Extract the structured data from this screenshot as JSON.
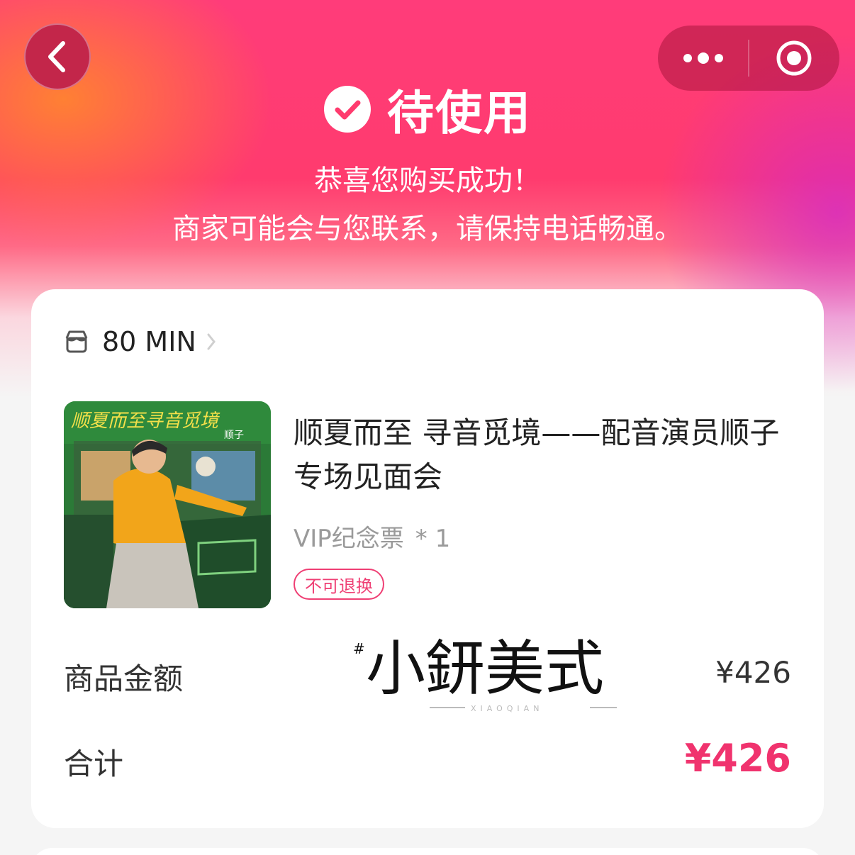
{
  "header": {
    "status": "待使用",
    "message_line1": "恭喜您购买成功！",
    "message_line2": "商家可能会与您联系，请保持电话畅通。"
  },
  "nav": {
    "back_icon": "chevron-left-icon",
    "more_icon": "more-dots-icon",
    "close_icon": "target-close-icon"
  },
  "order": {
    "shop_name": "80 MIN",
    "item_title": "顺夏而至 寻音觅境——配音演员顺子专场见面会",
    "spec": "VIP纪念票",
    "quantity": "* 1",
    "tag": "不可退换",
    "poster_title": "顺夏而至寻音觅境",
    "poster_sub": "顺子"
  },
  "summary": {
    "subtotal_label": "商品金额",
    "subtotal_value": "¥426",
    "total_label": "合计",
    "total_value": "¥426"
  },
  "watermark": {
    "text": "小鈃美式",
    "sub": "XIAOQIAN",
    "hash": "#"
  },
  "colors": {
    "brand_pink": "#f0336e",
    "header_red": "#ff3b6e"
  }
}
